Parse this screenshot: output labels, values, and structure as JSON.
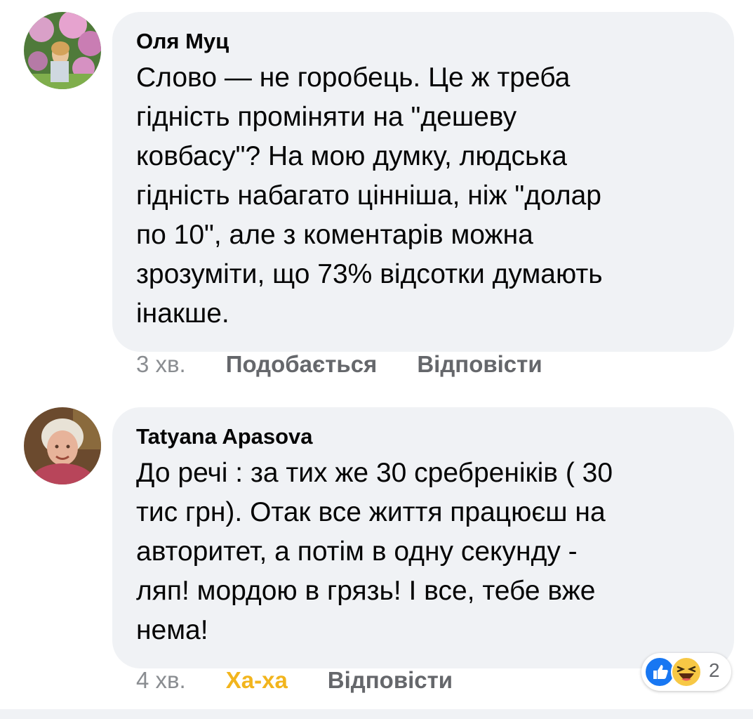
{
  "comments": [
    {
      "author": "Оля Муц",
      "text": "Слово — не горобець. Це ж треба\nгідність проміняти на \"дешеву\nковбасу\"? На мою думку, людська\nгідність набагато цінніша, ніж \"долар\nпо  10\", але з коментарів можна\nзрозуміти, що 73% відсотки думають\nінакше.",
      "time": "3 хв.",
      "like_label": "Подобається",
      "reply_label": "Відповісти"
    },
    {
      "author": "Tatyana Apasova",
      "text": "До речі : за тих же 30 сребреніків ( 30\nтис грн). Отак все життя працюєш на\nавторитет, а потім в одну секунду -\nляп! мордою в грязь! І все, тебе вже\nнема!",
      "time": "4 хв.",
      "reaction_label": "Ха-ха",
      "reply_label": "Відповісти",
      "reactions": {
        "icons": [
          "like-icon",
          "haha-icon"
        ],
        "count": "2"
      }
    }
  ],
  "colors": {
    "bubble": "#f0f2f5",
    "meta": "#65676b",
    "haha": "#f2b51d",
    "like": "#1877f2"
  }
}
